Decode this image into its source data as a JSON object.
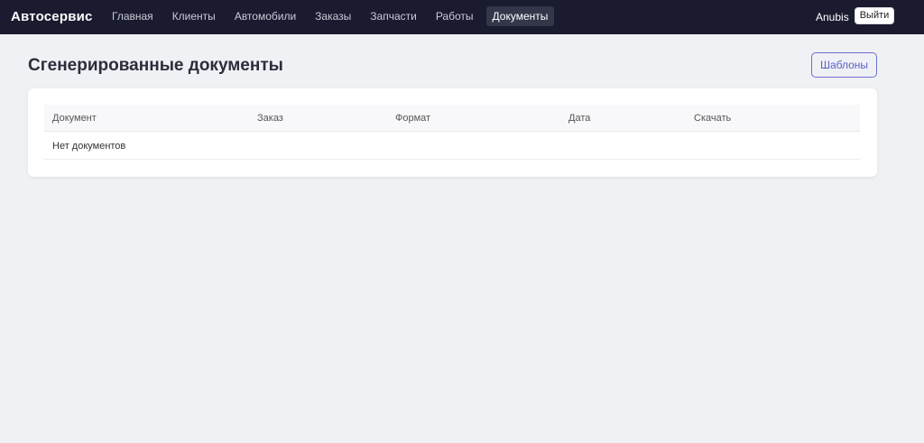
{
  "navbar": {
    "brand": "Автосервис",
    "links": [
      {
        "label": "Главная",
        "active": false
      },
      {
        "label": "Клиенты",
        "active": false
      },
      {
        "label": "Автомобили",
        "active": false
      },
      {
        "label": "Заказы",
        "active": false
      },
      {
        "label": "Запчасти",
        "active": false
      },
      {
        "label": "Работы",
        "active": false
      },
      {
        "label": "Документы",
        "active": true
      }
    ],
    "user_name": "Anubis",
    "logout_label": "Выйти"
  },
  "page": {
    "title": "Сгенерированные документы",
    "templates_button": "Шаблоны"
  },
  "table": {
    "columns": [
      "Документ",
      "Заказ",
      "Формат",
      "Дата",
      "Скачать"
    ],
    "empty_message": "Нет документов"
  },
  "colors": {
    "navbar_bg": "#1a1b2f",
    "page_bg": "#f0f1f5",
    "accent": "#5a60c8"
  }
}
